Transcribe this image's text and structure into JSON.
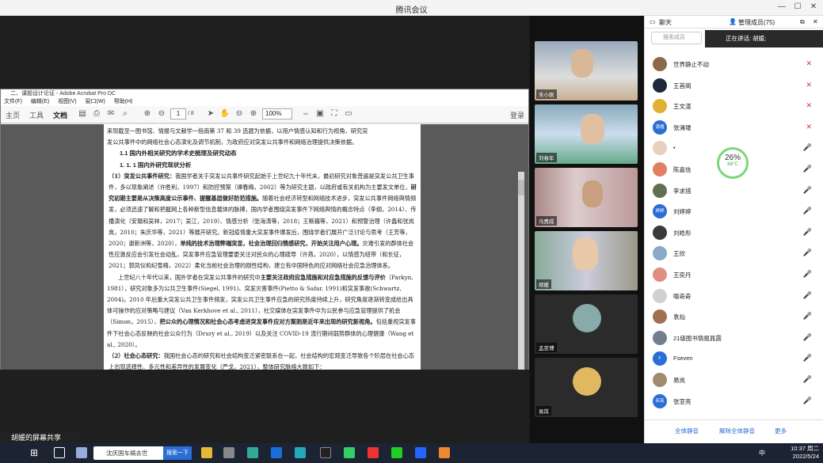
{
  "window": {
    "title": "腾讯会议"
  },
  "acrobat": {
    "title": "二、课题设计论证 - Adobe Acrobat Pro DC",
    "menu": [
      "文件(F)",
      "编辑(E)",
      "视图(V)",
      "窗口(W)",
      "帮助(H)"
    ],
    "tabs": [
      "主页",
      "工具",
      "文档"
    ],
    "page_current": "1",
    "page_total": "/ 8",
    "zoom": "100%",
    "login": "登录"
  },
  "doc": {
    "l0": "来现截至一图书馆、情报与文献学一指南第 37 和 39 选题为依据，以用户情感认知和行为视角，研究突",
    "l1": "发公共事件中的网络社会心态演化及调节机制，为政府应对突发公共事件和网络治理提供决策依据。",
    "h1": "1.1 国内外相关研究的学术史梳理及研究动态",
    "h2": "1. 1. 1 国内外研究现状分析",
    "p1a": "（1）突发公共事件研究：",
    "p1b": "我国学者关于突发公共事件研究起始于上世纪九十年代末，最初研究对象普遍是突发公共卫生事件，多以现象阐述（许胜利，1997）和防控预案（谭春梅，2002）等为研究主题，以政府或有关机构为主要发文单位，",
    "p1c": "研究初期主要是从决策高度公示事件、提醒基层做好防范措施。",
    "p1d": "随着社会经济转型和网络技术进步，突发公共事件网络舆情频发，必须迅速了解和把握网上各种新型信息载体的脉搏，国内学者围绕突发事件下网络舆情的概念特点（李纲，2014）、传播演化（安璐和吴林，2017；吴江，2019）、情感分析（张海涛等，2018；王晰巍等，2021）和预警治理（许鑫和张岚岚，2010；朱庆华等，2021）等展开研究。新冠疫情重大突发事件爆发后，围绕学者们展开广泛讨论与思考（王芳等，2020；谢新洲等，2020），",
    "p1e": "单纯的技术治理弊端突显，社会治理回归情感研究，开始关注用户心理。",
    "p1f": "灾难引发的群体社会性应激反应会引发社会动乱，突发事件应急管理要更关注对民众的心理疏导（许燕，2020），以情感为纽带（和长征，2021；郭凤仪和纪雪梅，2022）柔化当前社会治理的刚性结构，建立有中国特色的应对网络社会应急治理体系。",
    "p2a": "上世纪八十年代以来，国外学者在突发公共事件的研究中",
    "p2b": "主要关注政府应急措施和对应急措施的反馈与评价",
    "p2c": "（Parkyn, 1981），研究对象多为公共卫生事件(Siegel, 1991)、突发灾害事件(Pietto & Safar, 1991)和突发事故(Schwartz, 2004)。2010 年后重大突发公共卫生事件频发，突发公共卫生事件应急的研究热度持续上升，研究角度逐渐转变成给出具体可操作的应对策略与建议（Van Kerkhove et al., 2011），社交媒体在突发事件中为公民参与应急管理提供了机会（Simon，2015），",
    "p2d": "把公众的心理情况和社会心态考虑进突发事件应对方案则是近年来出现的研究新视角。",
    "p2e": "包括重视突发事件下社会心态反映的社会公众行为（Drury et al., 2019）以及关注 COVID-19 流行期间弱势群体的心理健康（Wang et al., 2020）。",
    "p3a": "（2）社会心态研究：",
    "p3b": "我国社会心态的研究和社会结构变迁紧密联系在一起，社会结构的宏观变迁导致各个阶层在社会心态上出现选择性、多元性和差异性的发展变化（严戈，2021），整体研究脉络大致如下："
  },
  "share": {
    "label": "胡媛的屏幕共享"
  },
  "videos": [
    {
      "name": "朱小刚",
      "kind": "cam"
    },
    {
      "name": "刘春年",
      "kind": "cam"
    },
    {
      "name": "马费成",
      "kind": "cam"
    },
    {
      "name": "胡媛",
      "kind": "cam"
    },
    {
      "name": "孟亚博",
      "kind": "avatar"
    },
    {
      "name": "易岚",
      "kind": "avatar"
    }
  ],
  "panel": {
    "tab_chat": "聊天",
    "tab_members": "管理成员(75)",
    "search_placeholder": "搜索成员",
    "speaking": "正在讲话: 胡媛;",
    "members": [
      {
        "name": "世界静止不动",
        "av": "",
        "color": "#8a6a4a",
        "mic": "off"
      },
      {
        "name": "王首阁",
        "av": "",
        "color": "#1d2a3a",
        "mic": "off"
      },
      {
        "name": "王文湛",
        "av": "",
        "color": "#e0b030",
        "mic": "off"
      },
      {
        "name": "张涌堰",
        "av": "涌堰",
        "color": "#2a6ed6",
        "mic": "off"
      },
      {
        "name": "•",
        "av": "",
        "color": "#e8d0c0",
        "mic": "on"
      },
      {
        "name": "陈嘉信",
        "av": "",
        "color": "#e08060",
        "mic": "on"
      },
      {
        "name": "李求措",
        "av": "",
        "color": "#607050",
        "mic": "on"
      },
      {
        "name": "刘婷婷",
        "av": "婷婷",
        "color": "#2a6ed6",
        "mic": "on"
      },
      {
        "name": "刘皓彤",
        "av": "",
        "color": "#3a3a3a",
        "mic": "on"
      },
      {
        "name": "王欣",
        "av": "",
        "color": "#8aa8c8",
        "mic": "on"
      },
      {
        "name": "王奕丹",
        "av": "",
        "color": "#e09080",
        "mic": "on"
      },
      {
        "name": "喻奇奇",
        "av": "",
        "color": "#d0d0d0",
        "mic": "on"
      },
      {
        "name": "袁灿",
        "av": "",
        "color": "#a07050",
        "mic": "on"
      },
      {
        "name": "21级图书情报晁霞",
        "av": "",
        "color": "#708090",
        "mic": "on"
      },
      {
        "name": "Fseven",
        "av": "F",
        "color": "#2a6ed6",
        "mic": "on"
      },
      {
        "name": "易岚",
        "av": "",
        "color": "#a08a70",
        "mic": "on"
      },
      {
        "name": "张亚亮",
        "av": "亚亮",
        "color": "#2a6ed6",
        "mic": "on"
      }
    ],
    "mute_all": "全体静音",
    "unmute_all": "解除全体静音",
    "more": "更多"
  },
  "gauge": {
    "value": "26%",
    "temp": "68°C"
  },
  "taskbar": {
    "search": "沈庆国车祸去世",
    "search_btn": "搜索一下",
    "time": "10:37 周二",
    "date": "2022/5/24",
    "ime": "中"
  },
  "colors": {
    "accent": "#2a6ed6"
  }
}
